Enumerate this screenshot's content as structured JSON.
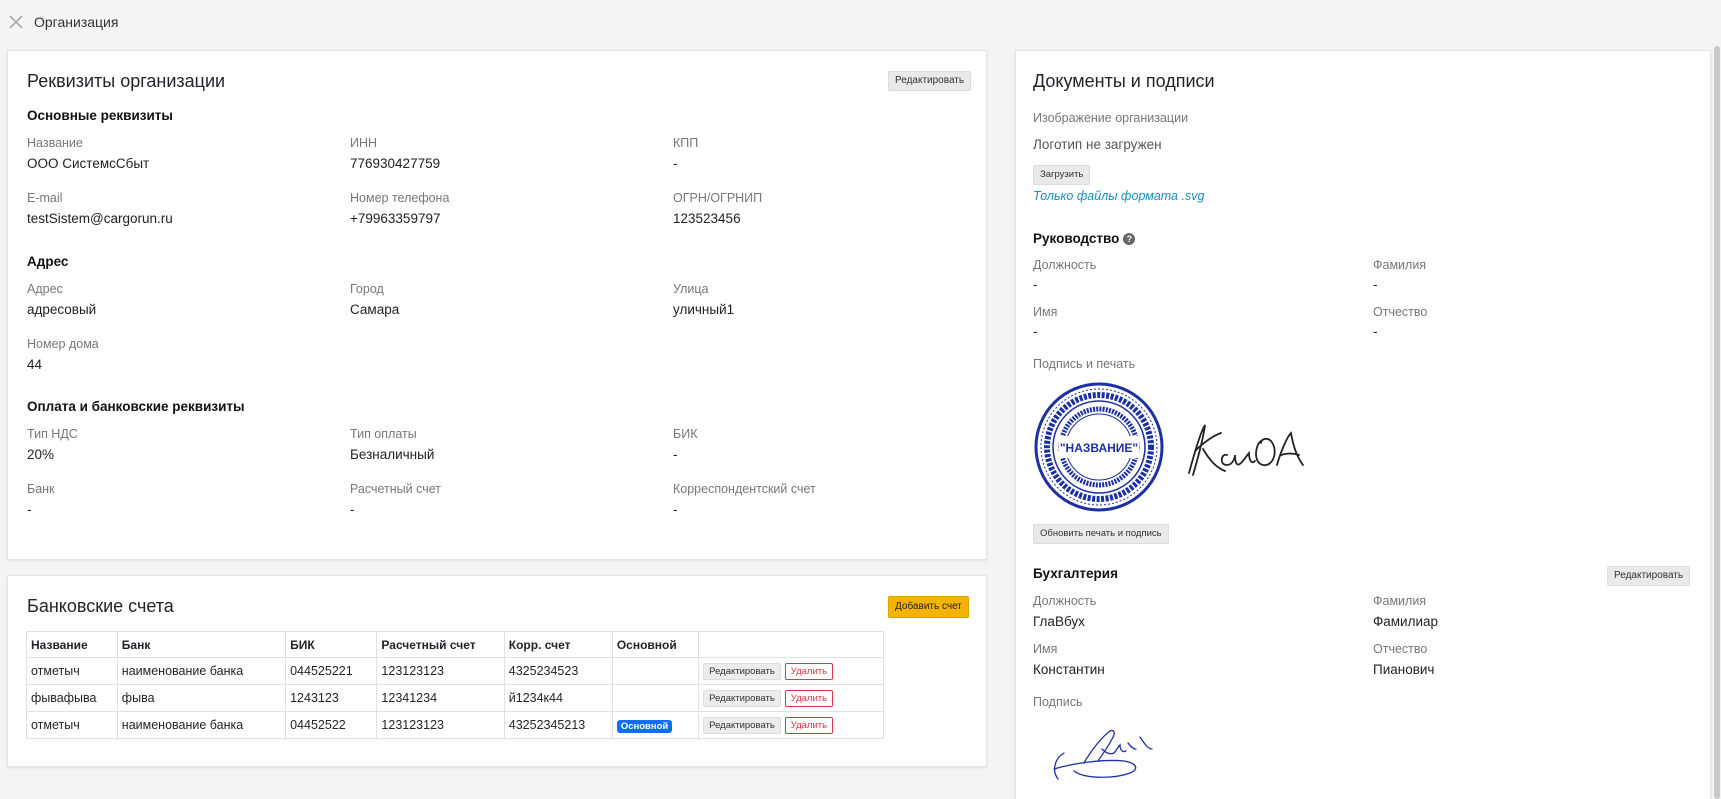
{
  "header": {
    "title": "Организация"
  },
  "requisites": {
    "title": "Реквизиты организации",
    "edit_label": "Редактировать",
    "main_section": "Основные реквизиты",
    "name_label": "Название",
    "name_value": "ООО СистемсСбыт",
    "inn_label": "ИНН",
    "inn_value": "776930427759",
    "kpp_label": "КПП",
    "kpp_value": "-",
    "email_label": "E-mail",
    "email_value": "testSistem@cargorun.ru",
    "phone_label": "Номер телефона",
    "phone_value": "+79963359797",
    "ogrn_label": "ОГРН/ОГРНИП",
    "ogrn_value": "123523456",
    "address_section": "Адрес",
    "address_label": "Адрес",
    "address_value": "адресовый",
    "city_label": "Город",
    "city_value": "Самара",
    "street_label": "Улица",
    "street_value": "уличный1",
    "house_label": "Номер дома",
    "house_value": "44",
    "payment_section": "Оплата и банковские реквизиты",
    "vat_label": "Тип НДС",
    "vat_value": "20%",
    "paytype_label": "Тип оплаты",
    "paytype_value": "Безналичный",
    "bik_label": "БИК",
    "bik_value": "-",
    "bank_label": "Банк",
    "bank_value": "-",
    "account_label": "Расчетный счет",
    "account_value": "-",
    "corr_label": "Корреспондентский счет",
    "corr_value": "-"
  },
  "bank_accounts": {
    "title": "Банковские счета",
    "add_label": "Добавить счет",
    "columns": [
      "Название",
      "Банк",
      "БИК",
      "Расчетный счет",
      "Корр. счет",
      "Основной",
      ""
    ],
    "edit_label": "Редактировать",
    "delete_label": "Удалить",
    "main_badge": "Основной",
    "rows": [
      {
        "name": "отметыч",
        "bank": "наименование банка",
        "bik": "044525221",
        "account": "123123123",
        "corr": "4325234523",
        "is_main": false
      },
      {
        "name": "фывафыва",
        "bank": "фыва",
        "bik": "1243123",
        "account": "12341234",
        "corr": "й1234к44",
        "is_main": false
      },
      {
        "name": "отметыч",
        "bank": "наименование банка",
        "bik": "04452522",
        "account": "123123123",
        "corr": "43252345213",
        "is_main": true
      }
    ]
  },
  "documents": {
    "title": "Документы и подписи",
    "image_label": "Изображение организации",
    "no_logo": "Логотип не загружен",
    "upload_label": "Загрузить",
    "svg_hint": "Только файлы формата .svg",
    "management_section": "Руководство",
    "position_label": "Должность",
    "position_value": "-",
    "surname_label": "Фамилия",
    "surname_value": "-",
    "firstname_label": "Имя",
    "firstname_value": "-",
    "patronymic_label": "Отчество",
    "patronymic_value": "-",
    "stamp_label": "Подпись и печать",
    "stamp_text": "\"НАЗВАНИЕ\"",
    "update_stamp_label": "Обновить печать и подпись",
    "accounting_section": "Бухгалтерия",
    "acc_edit_label": "Редактировать",
    "acc_position_label": "Должность",
    "acc_position_value": "ГлаВбух",
    "acc_surname_label": "Фамилия",
    "acc_surname_value": "Фамилиар",
    "acc_firstname_label": "Имя",
    "acc_firstname_value": "Константин",
    "acc_patronymic_label": "Отчество",
    "acc_patronymic_value": "Пианович",
    "signature_label": "Подпись"
  },
  "colors": {
    "accent_yellow": "#f5b301",
    "link_blue": "#1a8fbf",
    "badge_blue": "#0d6efd",
    "stamp_blue": "#1c2fa3"
  }
}
